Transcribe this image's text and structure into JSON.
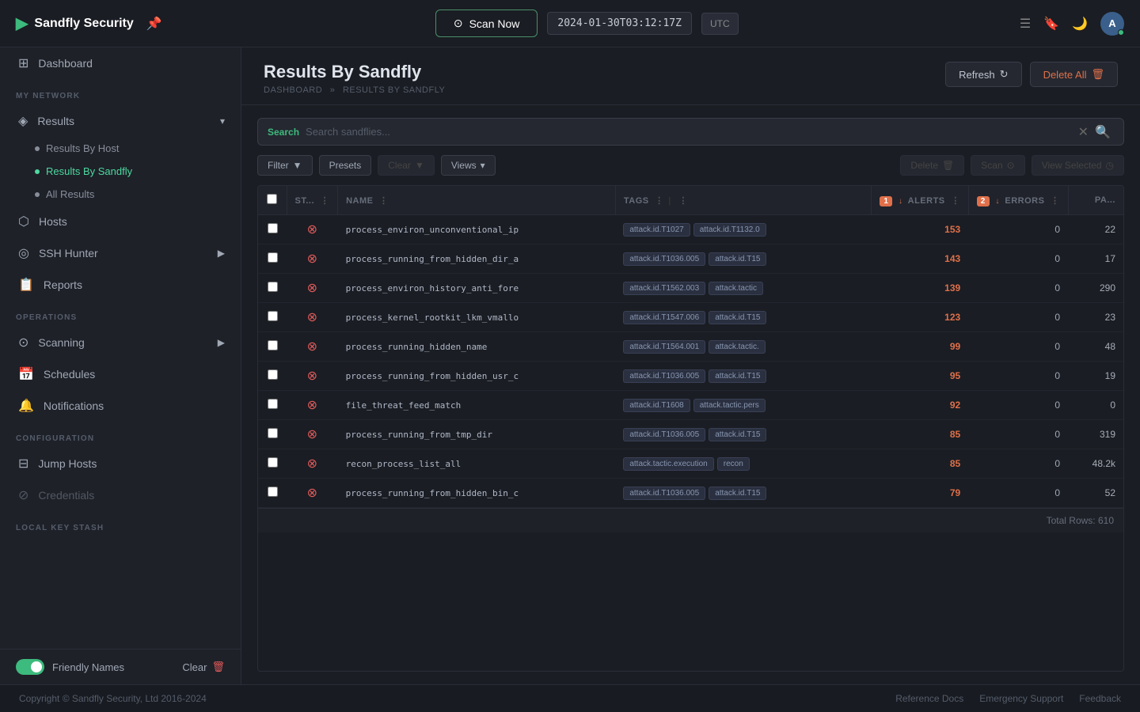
{
  "topbar": {
    "logo_text": "Sandfly Security",
    "logo_arrow": "▶",
    "scan_now_label": "Scan Now",
    "datetime": "2024-01-30T03:12:17Z",
    "timezone": "UTC"
  },
  "sidebar": {
    "my_network_label": "MY NETWORK",
    "operations_label": "OPERATIONS",
    "configuration_label": "CONFIGURATION",
    "local_key_stash_label": "LOCAL KEY STASH",
    "items": [
      {
        "id": "dashboard",
        "label": "Dashboard",
        "icon": "⊞"
      },
      {
        "id": "results",
        "label": "Results",
        "icon": "◈",
        "expandable": true
      },
      {
        "id": "results-by-host",
        "label": "Results By Host",
        "sub": true
      },
      {
        "id": "results-by-sandfly",
        "label": "Results By Sandfly",
        "sub": true,
        "active": true
      },
      {
        "id": "all-results",
        "label": "All Results",
        "sub": true
      },
      {
        "id": "hosts",
        "label": "Hosts",
        "icon": "⬡"
      },
      {
        "id": "ssh-hunter",
        "label": "SSH Hunter",
        "icon": "◎",
        "expandable": true
      },
      {
        "id": "reports",
        "label": "Reports",
        "icon": "⊟"
      },
      {
        "id": "scanning",
        "label": "Scanning",
        "icon": "⊙",
        "expandable": true
      },
      {
        "id": "schedules",
        "label": "Schedules",
        "icon": "⊟"
      },
      {
        "id": "notifications",
        "label": "Notifications",
        "icon": "🔔"
      },
      {
        "id": "jump-hosts",
        "label": "Jump Hosts",
        "icon": "⊟"
      },
      {
        "id": "credentials",
        "label": "Credentials",
        "icon": "⊘",
        "disabled": true
      }
    ],
    "friendly_names_label": "Friendly Names",
    "clear_label": "Clear"
  },
  "page": {
    "title": "Results By Sandfly",
    "breadcrumb_home": "DASHBOARD",
    "breadcrumb_sep": "»",
    "breadcrumb_current": "RESULTS BY SANDFLY"
  },
  "actions": {
    "refresh_label": "Refresh",
    "delete_all_label": "Delete All"
  },
  "search": {
    "label": "Search",
    "placeholder": "Search sandflies..."
  },
  "toolbar": {
    "filter_label": "Filter",
    "presets_label": "Presets",
    "clear_label": "Clear",
    "views_label": "Views",
    "delete_label": "Delete",
    "scan_label": "Scan",
    "view_selected_label": "View Selected"
  },
  "table": {
    "columns": [
      {
        "id": "status",
        "label": "ST...",
        "sortable": false
      },
      {
        "id": "name",
        "label": "NAME",
        "sortable": false
      },
      {
        "id": "tags",
        "label": "TAGS",
        "sortable": false
      },
      {
        "id": "alerts",
        "label": "ALERTS",
        "sortable": true,
        "badge": "1",
        "sort_dir": "desc"
      },
      {
        "id": "errors",
        "label": "ERRORS",
        "sortable": true,
        "badge": "2",
        "sort_dir": "desc"
      },
      {
        "id": "pa",
        "label": "PA...",
        "sortable": false
      }
    ],
    "rows": [
      {
        "status": "error",
        "name": "process_environ_unconventional_ip",
        "tags": [
          "attack.id.T1027",
          "attack.id.T1132.0"
        ],
        "alerts": "153",
        "errors": "0",
        "pa": "22"
      },
      {
        "status": "error",
        "name": "process_running_from_hidden_dir_a",
        "tags": [
          "attack.id.T1036.005",
          "attack.id.T15"
        ],
        "alerts": "143",
        "errors": "0",
        "pa": "17"
      },
      {
        "status": "error",
        "name": "process_environ_history_anti_fore",
        "tags": [
          "attack.id.T1562.003",
          "attack.tactic"
        ],
        "alerts": "139",
        "errors": "0",
        "pa": "290"
      },
      {
        "status": "error",
        "name": "process_kernel_rootkit_lkm_vmallo",
        "tags": [
          "attack.id.T1547.006",
          "attack.id.T15"
        ],
        "alerts": "123",
        "errors": "0",
        "pa": "23"
      },
      {
        "status": "error",
        "name": "process_running_hidden_name",
        "tags": [
          "attack.id.T1564.001",
          "attack.tactic."
        ],
        "alerts": "99",
        "errors": "0",
        "pa": "48"
      },
      {
        "status": "error",
        "name": "process_running_from_hidden_usr_c",
        "tags": [
          "attack.id.T1036.005",
          "attack.id.T15"
        ],
        "alerts": "95",
        "errors": "0",
        "pa": "19"
      },
      {
        "status": "error",
        "name": "file_threat_feed_match",
        "tags": [
          "attack.id.T1608",
          "attack.tactic.pers"
        ],
        "alerts": "92",
        "errors": "0",
        "pa": "0"
      },
      {
        "status": "error",
        "name": "process_running_from_tmp_dir",
        "tags": [
          "attack.id.T1036.005",
          "attack.id.T15"
        ],
        "alerts": "85",
        "errors": "0",
        "pa": "319"
      },
      {
        "status": "error",
        "name": "recon_process_list_all",
        "tags": [
          "attack.tactic.execution",
          "recon"
        ],
        "alerts": "85",
        "errors": "0",
        "pa": "48.2k"
      },
      {
        "status": "error",
        "name": "process_running_from_hidden_bin_c",
        "tags": [
          "attack.id.T1036.005",
          "attack.id.T15"
        ],
        "alerts": "79",
        "errors": "0",
        "pa": "52"
      }
    ],
    "total_rows_label": "Total Rows:",
    "total_rows_value": "610"
  },
  "footer": {
    "copyright": "Copyright © Sandfly Security, Ltd 2016-2024",
    "links": [
      "Reference Docs",
      "Emergency Support",
      "Feedback"
    ]
  }
}
